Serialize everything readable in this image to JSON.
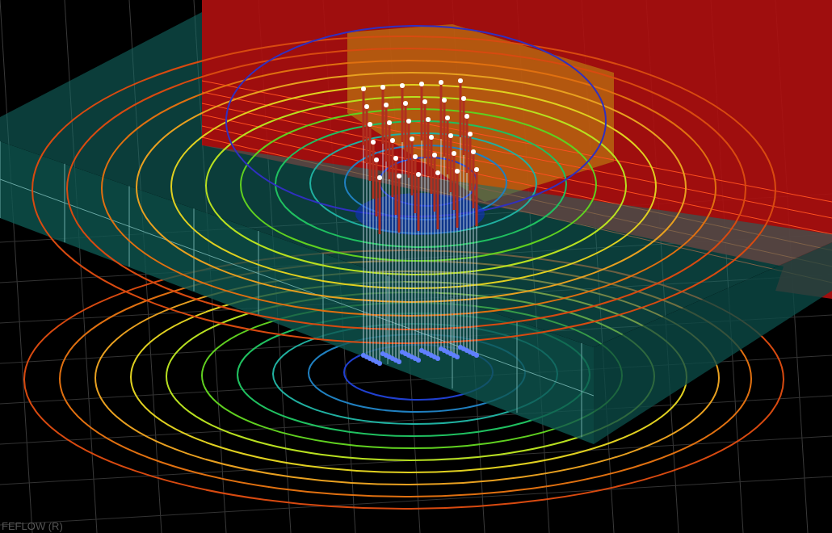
{
  "viewport": {
    "label": "FEFLOW (R)"
  }
}
